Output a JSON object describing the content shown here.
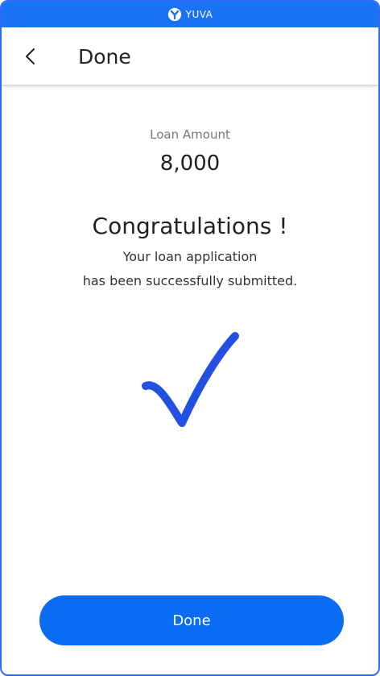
{
  "brand": {
    "name": "YUVA",
    "icon": "yuva-logo-icon",
    "bar_color": "#1a73f5"
  },
  "header": {
    "back_icon": "chevron-left-icon",
    "title": "Done"
  },
  "loan": {
    "label": "Loan Amount",
    "amount": "8,000"
  },
  "message": {
    "headline": "Congratulations !",
    "line1": "Your loan application",
    "line2": "has been successfully submitted."
  },
  "status_icon": {
    "name": "checkmark-icon",
    "color": "#2350e0"
  },
  "footer": {
    "done_label": "Done",
    "button_color": "#0a6cf2"
  }
}
